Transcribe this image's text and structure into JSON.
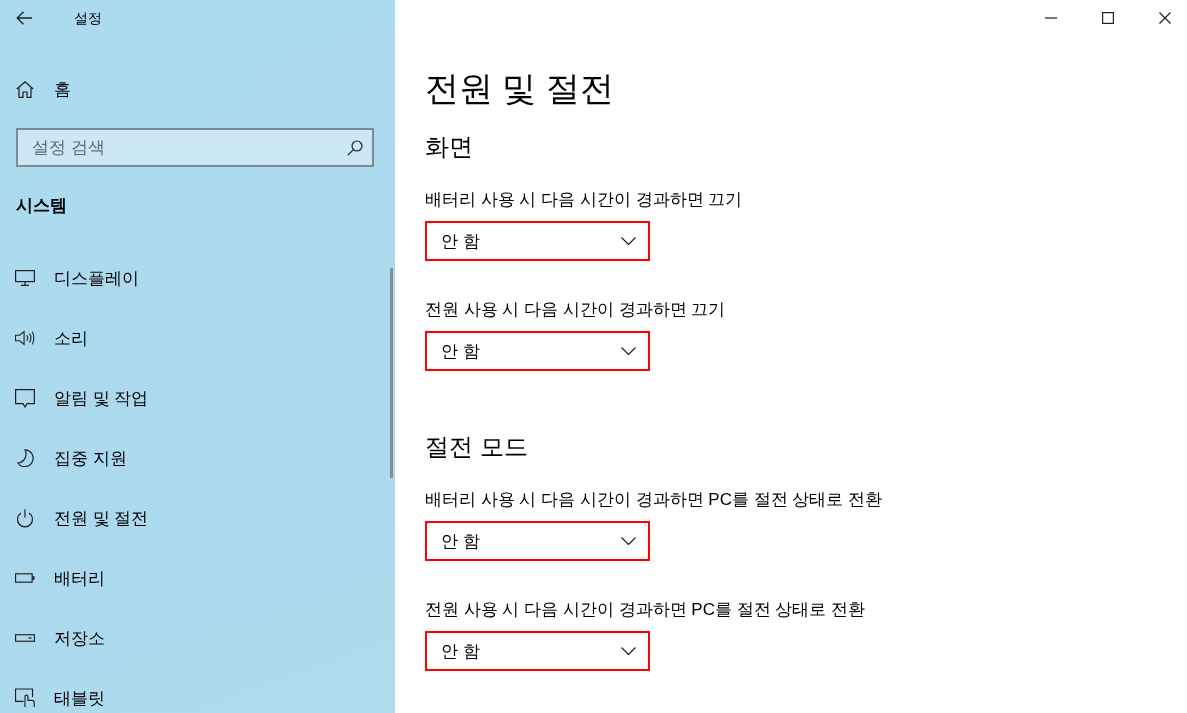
{
  "window": {
    "title": "설정"
  },
  "sidebar": {
    "home": "홈",
    "search": {
      "placeholder": "설정 검색"
    },
    "section_title": "시스템",
    "items": [
      "디스플레이",
      "소리",
      "알림 및 작업",
      "집중 지원",
      "전원 및 절전",
      "배터리",
      "저장소",
      "태블릿"
    ]
  },
  "page": {
    "title": "전원 및 절전",
    "sections": [
      {
        "heading": "화면",
        "settings": [
          {
            "label": "배터리 사용 시 다음 시간이 경과하면 끄기",
            "value": "안 함",
            "highlighted": true
          },
          {
            "label": "전원 사용 시 다음 시간이 경과하면 끄기",
            "value": "안 함",
            "highlighted": true
          }
        ]
      },
      {
        "heading": "절전 모드",
        "settings": [
          {
            "label": "배터리 사용 시 다음 시간이 경과하면 PC를 절전 상태로 전환",
            "value": "안 함",
            "highlighted": true
          },
          {
            "label": "전원 사용 시 다음 시간이 경과하면 PC를 절전 상태로 전환",
            "value": "안 함",
            "highlighted": true
          }
        ]
      }
    ]
  }
}
